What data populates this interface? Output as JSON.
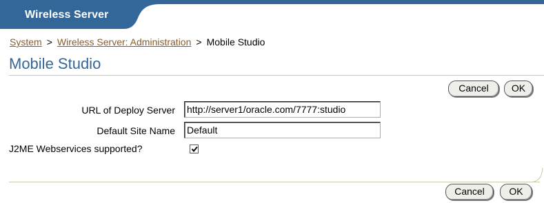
{
  "header": {
    "app_title": "Wireless Server"
  },
  "breadcrumb": {
    "items": [
      "System",
      "Wireless Server: Administration",
      "Mobile Studio"
    ],
    "separator": ">"
  },
  "page": {
    "title": "Mobile Studio"
  },
  "buttons": {
    "cancel_label": "Cancel",
    "ok_label": "OK"
  },
  "form": {
    "deploy_server_label": "URL of Deploy Server",
    "deploy_server_value": "http://server1/oracle.com/7777:studio",
    "site_name_label": "Default Site Name",
    "site_name_value": "Default",
    "j2me_label": "J2ME Webservices supported?",
    "j2me_checked": true
  },
  "colors": {
    "header_blue": "#336699",
    "link_brown": "#8b5a2b",
    "title_blue": "#336699"
  }
}
